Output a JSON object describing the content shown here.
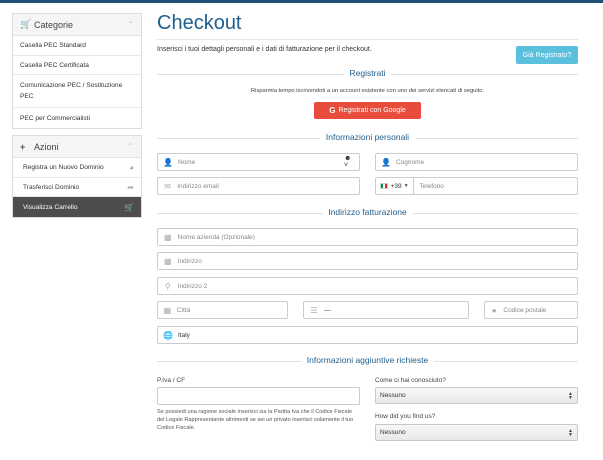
{
  "sidebar": {
    "categorie": {
      "title": "Categorie",
      "items": [
        "Casella PEC Standard",
        "Casella PEC Certificata",
        "Comunicazione PEC / Sostituzione PEC",
        "PEC per Commercialisti"
      ]
    },
    "azioni": {
      "title": "Azioni",
      "items": [
        "Registra un Nuovo Dominio",
        "Trasferisci Dominio",
        "Visualizza Carrello"
      ]
    }
  },
  "main": {
    "title": "Checkout",
    "intro": "Inserisci i tuoi dettagli personali e i dati di fatturazione per il checkout.",
    "already_registered": "Già Registrato?",
    "registrati": {
      "heading": "Registrati",
      "hint": "Risparmia tempo iscrivendoti a un account esistente con uno dei servizi elencati di seguito.",
      "google_button": "Registrati con Google"
    },
    "personal": {
      "heading": "Informazioni personali",
      "nome_placeholder": "Nome",
      "cognome_placeholder": "Cognome",
      "email_placeholder": "Indirizzo email",
      "phone_code": "+39",
      "phone_placeholder": "Telefono"
    },
    "billing": {
      "heading": "Indirizzo fatturazione",
      "company_placeholder": "Nome azienda (Opzionale)",
      "address_placeholder": "Indirizzo",
      "address2_placeholder": "Indirizzo 2",
      "city_placeholder": "Città",
      "state_value": "—",
      "postcode_placeholder": "Codice postale",
      "country_value": "Italy"
    },
    "additional": {
      "heading": "Informazioni aggiuntive richieste",
      "piva_label": "P.Iva / CF",
      "piva_note": "Se possiedi una ragione sociale inserisci sia la Partita Iva che il Codice Fiscale del Legale Rappresentante altrimenti se sei un privato inserisci solamente il tuo Codice Fiscale.",
      "how_known_label": "Come ci hai conosciuto?",
      "how_known_value": "Nessuno",
      "how_found_label": "How did you find us?",
      "how_found_value": "Nessuno"
    }
  },
  "colors": {
    "accent": "#1f5f8e",
    "info_button": "#5bc0de",
    "google_button": "#e74c3c",
    "active_item": "#4d4d4d"
  }
}
